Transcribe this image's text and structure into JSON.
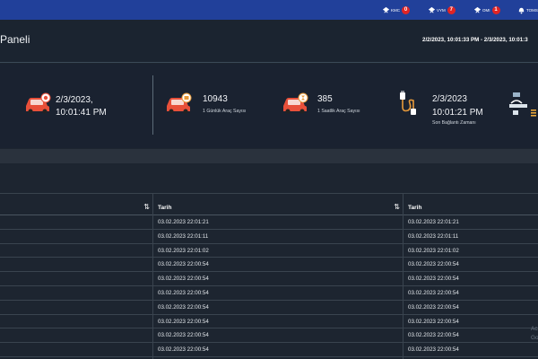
{
  "topbar": {
    "items": [
      {
        "label": "KMC",
        "count": "0"
      },
      {
        "label": "VYM",
        "count": "7"
      },
      {
        "label": "OMI",
        "count": "1"
      },
      {
        "label": "TOMS",
        "count": ""
      }
    ]
  },
  "header": {
    "title": "Paneli",
    "date_range": "2/2/2023, 10:01:33 PM - 2/3/2023, 10:01:3"
  },
  "stats": {
    "s1": {
      "line1": "2/3/2023,",
      "line2": "10:01:41 PM"
    },
    "s2": {
      "value": "10943",
      "label": "1 Günlük Araç Sayısı"
    },
    "s3": {
      "value": "385",
      "label": "1 Saatlik Araç Sayısı"
    },
    "s4": {
      "line1": "2/3/2023",
      "line2": "10:01:21 PM",
      "label": "Son Bağlantı Zamanı"
    }
  },
  "table_left": {
    "header": "Tarih",
    "rows": [
      "03.02.2023 22:01:21",
      "03.02.2023 22:01:11",
      "03.02.2023 22:01:02",
      "03.02.2023 22:00:54",
      "03.02.2023 22:00:54",
      "03.02.2023 22:00:54",
      "03.02.2023 22:00:54",
      "03.02.2023 22:00:54",
      "03.02.2023 22:00:54",
      "03.02.2023 22:00:54"
    ]
  },
  "table_right": {
    "header": "Tarih",
    "rows": [
      "03.02.2023 22:01:21",
      "03.02.2023 22:01:11",
      "03.02.2023 22:01:02",
      "03.02.2023 22:00:54",
      "03.02.2023 22:00:54",
      "03.02.2023 22:00:54",
      "03.02.2023 22:00:54",
      "03.02.2023 22:00:54",
      "03.02.2023 22:00:54",
      "03.02.2023 22:00:54"
    ]
  },
  "watermark": {
    "line1": "Ac",
    "line2": "Go"
  },
  "colors": {
    "topbar": "#21409a",
    "badge": "#e02424",
    "car": "#e8503a",
    "background": "#1d2530"
  }
}
